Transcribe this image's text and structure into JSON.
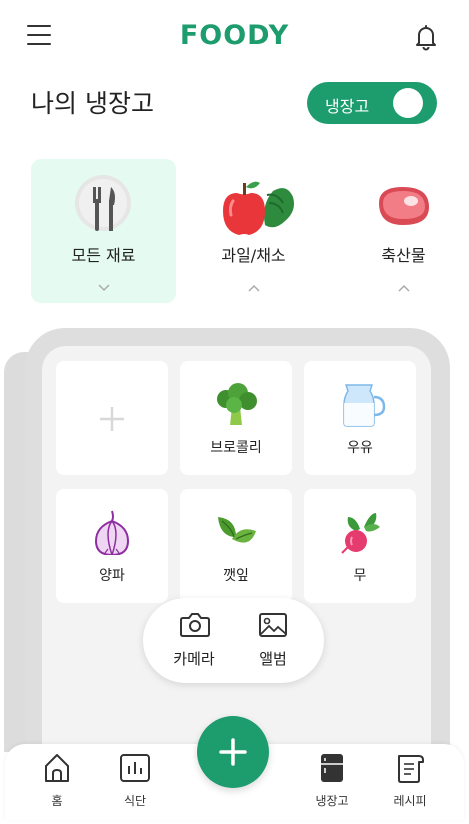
{
  "app": {
    "logo": "FOODY"
  },
  "header": {
    "title": "나의 냉장고"
  },
  "toggle": {
    "label": "냉장고",
    "on": true
  },
  "colors": {
    "accent": "#1d9c6e",
    "active_category_bg": "#e5fbf2"
  },
  "categories": [
    {
      "label": "모든 재료",
      "icon": "utensils-icon",
      "active": true,
      "arrow": "chevron-down-icon"
    },
    {
      "label": "과일/채소",
      "icon": "apple-vegetable-icon",
      "active": false,
      "arrow": "chevron-up-icon"
    },
    {
      "label": "축산물",
      "icon": "meat-icon",
      "active": false,
      "arrow": "chevron-up-icon"
    }
  ],
  "ingredients": [
    {
      "label": "",
      "icon": "plus-icon"
    },
    {
      "label": "브로콜리",
      "icon": "broccoli-icon"
    },
    {
      "label": "우유",
      "icon": "milk-icon"
    },
    {
      "label": "양파",
      "icon": "onion-icon"
    },
    {
      "label": "깻잎",
      "icon": "leaf-icon"
    },
    {
      "label": "무",
      "icon": "radish-icon"
    }
  ],
  "add_menu": {
    "camera": "카메라",
    "album": "앨범"
  },
  "nav": {
    "home": "홈",
    "diet": "식단",
    "fridge": "냉장고",
    "recipe": "레시피"
  }
}
